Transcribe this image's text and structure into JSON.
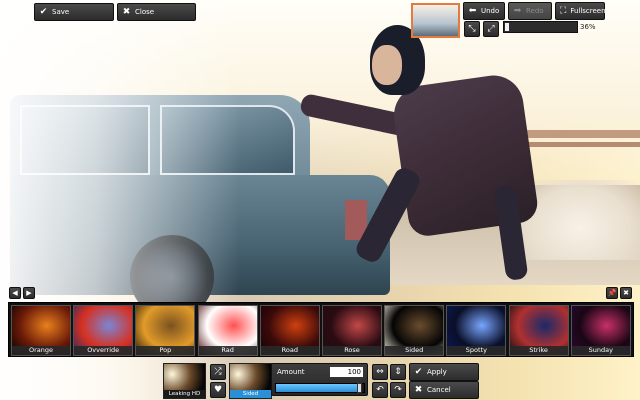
{
  "toolbar_top_left": {
    "save_label": "Save",
    "close_label": "Close"
  },
  "toolbar_top_right": {
    "undo_label": "Undo",
    "redo_label": "Redo",
    "fullscreen_label": "Fullscreen",
    "zoom_percent_label": "36%",
    "zoom_fraction": 0.06
  },
  "filters": [
    {
      "label": "Orange",
      "c1": "#000000",
      "c2": "#e8801e",
      "c3": "#6b1a08"
    },
    {
      "label": "Ovverride",
      "c1": "#1f2a6a",
      "c2": "#7a86d6",
      "c3": "#d63020"
    },
    {
      "label": "Pop",
      "c1": "#1b1208",
      "c2": "#7a5220",
      "c3": "#e29b2a"
    },
    {
      "label": "Rad",
      "c1": "#4a0000",
      "c2": "#ff5050",
      "c3": "#ffffff"
    },
    {
      "label": "Road",
      "c1": "#120306",
      "c2": "#d0400f",
      "c3": "#3b0a0a"
    },
    {
      "label": "Rose",
      "c1": "#1e0d10",
      "c2": "#c24848",
      "c3": "#2a0b12"
    },
    {
      "label": "Sided",
      "c1": "#fff6e0",
      "c2": "#6a4c2e",
      "c3": "#050505"
    },
    {
      "label": "Spotty",
      "c1": "#0b1d5a",
      "c2": "#78a6ff",
      "c3": "#0a0e28"
    },
    {
      "label": "Strike",
      "c1": "#0a0a0a",
      "c2": "#1a2a6a",
      "c3": "#b03030"
    },
    {
      "label": "Sunday",
      "c1": "#2a0a3a",
      "c2": "#c8306a",
      "c3": "#1a0614"
    }
  ],
  "bottom": {
    "leaking_label": "Leaking HD",
    "selected_label": "Sided",
    "amount_label": "Amount",
    "amount_value": "100",
    "amount_fraction": 0.96,
    "apply_label": "Apply",
    "cancel_label": "Cancel"
  },
  "icons": {
    "save": "checkmark-icon",
    "close": "x-icon",
    "undo": "arrow-left-icon",
    "redo": "arrow-right-icon",
    "fullscreen": "expand-icon"
  },
  "colors": {
    "accent_blue": "#2a8fd6",
    "thumb_border": "#e47a3f"
  }
}
